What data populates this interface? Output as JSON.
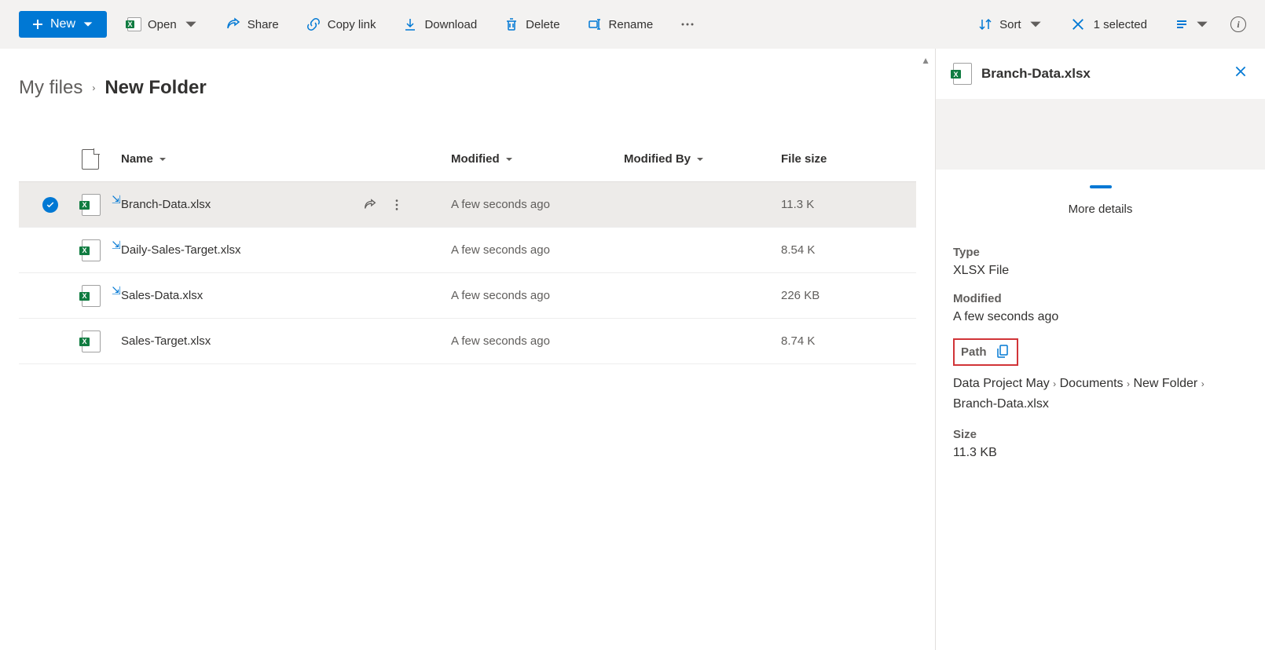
{
  "toolbar": {
    "new": "New",
    "open": "Open",
    "share": "Share",
    "copy_link": "Copy link",
    "download": "Download",
    "delete": "Delete",
    "rename": "Rename",
    "sort": "Sort",
    "selected": "1 selected"
  },
  "breadcrumb": {
    "root": "My files",
    "current": "New Folder"
  },
  "columns": {
    "name": "Name",
    "modified": "Modified",
    "modified_by": "Modified By",
    "size": "File size"
  },
  "files": [
    {
      "name": "Branch-Data.xlsx",
      "modified": "A few seconds ago",
      "modified_by": "",
      "size": "11.3 KB",
      "syncing": true,
      "selected": true
    },
    {
      "name": "Daily-Sales-Target.xlsx",
      "modified": "A few seconds ago",
      "modified_by": "",
      "size": "8.54 KB",
      "syncing": true,
      "selected": false
    },
    {
      "name": "Sales-Data.xlsx",
      "modified": "A few seconds ago",
      "modified_by": "",
      "size": "226 KB",
      "syncing": true,
      "selected": false
    },
    {
      "name": "Sales-Target.xlsx",
      "modified": "A few seconds ago",
      "modified_by": "",
      "size": "8.74 KB",
      "syncing": false,
      "selected": false
    }
  ],
  "details": {
    "title": "Branch-Data.xlsx",
    "more": "More details",
    "type_label": "Type",
    "type_value": "XLSX File",
    "modified_label": "Modified",
    "modified_value": "A few seconds ago",
    "path_label": "Path",
    "path_parts": [
      "Data Project May",
      "Documents",
      "New Folder",
      "Branch-Data.xlsx"
    ],
    "size_label": "Size",
    "size_value": "11.3 KB"
  }
}
